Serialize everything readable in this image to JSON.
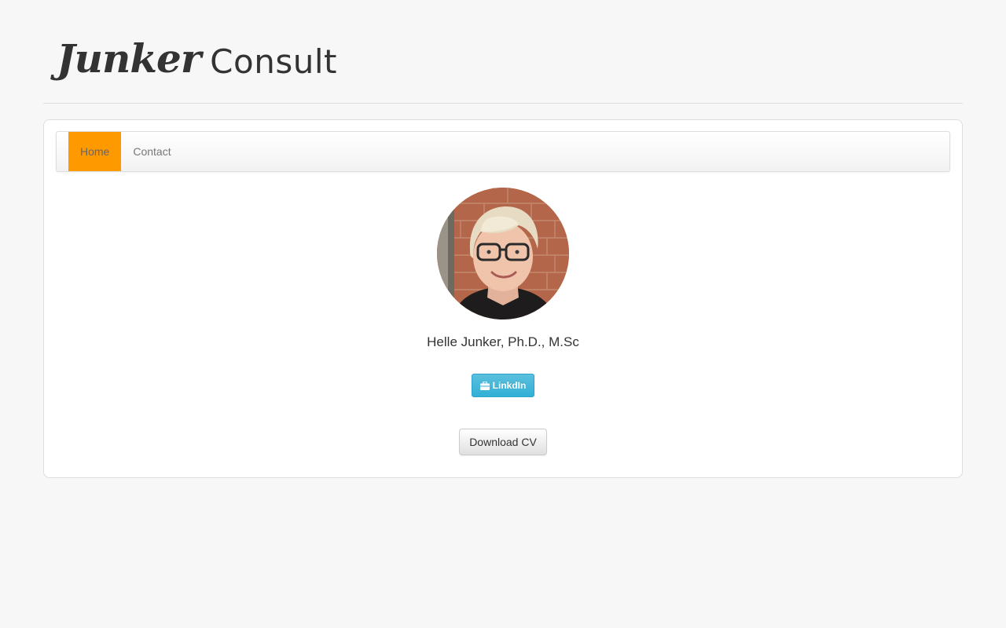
{
  "brand": {
    "script_text": "Junker",
    "sans_text": "Consult"
  },
  "nav": {
    "items": [
      {
        "label": "Home",
        "active": true
      },
      {
        "label": "Contact",
        "active": false
      }
    ],
    "active_color": "#ff9900"
  },
  "profile": {
    "name": "Helle Junker, Ph.D., M.Sc",
    "linkedin_label": "LinkdIn",
    "linkedin_icon": "briefcase-icon",
    "download_label": "Download CV"
  },
  "colors": {
    "page_bg": "#f7f7f7",
    "info_button": "#5bc0de",
    "text": "#333333"
  }
}
